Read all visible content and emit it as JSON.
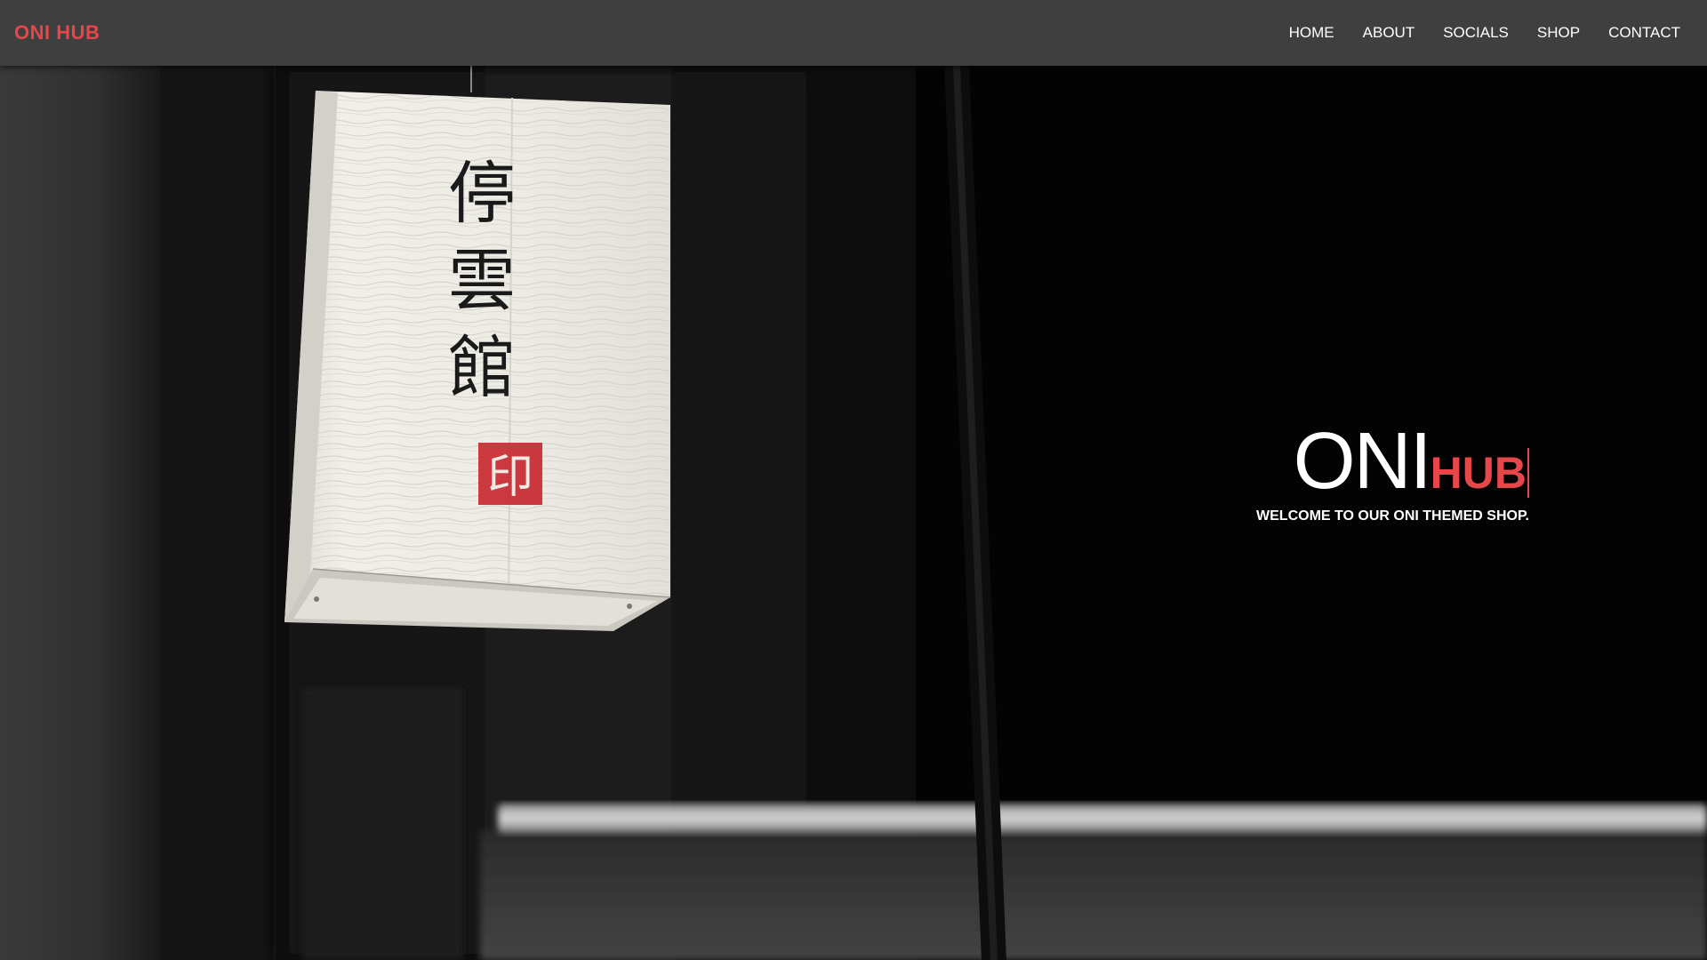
{
  "brand": {
    "name": "ONI HUB",
    "color": "#e5474b"
  },
  "nav": {
    "items": [
      {
        "label": "HOME"
      },
      {
        "label": "ABOUT"
      },
      {
        "label": "SOCIALS"
      },
      {
        "label": "SHOP"
      },
      {
        "label": "CONTACT"
      }
    ]
  },
  "hero": {
    "title_main": "ONI",
    "title_accent": "HUB",
    "subtitle": "WELCOME TO OUR ONI THEMED SHOP.",
    "lantern": {
      "calligraphy": [
        "停",
        "雲",
        "館"
      ],
      "seal_text": "印"
    }
  }
}
